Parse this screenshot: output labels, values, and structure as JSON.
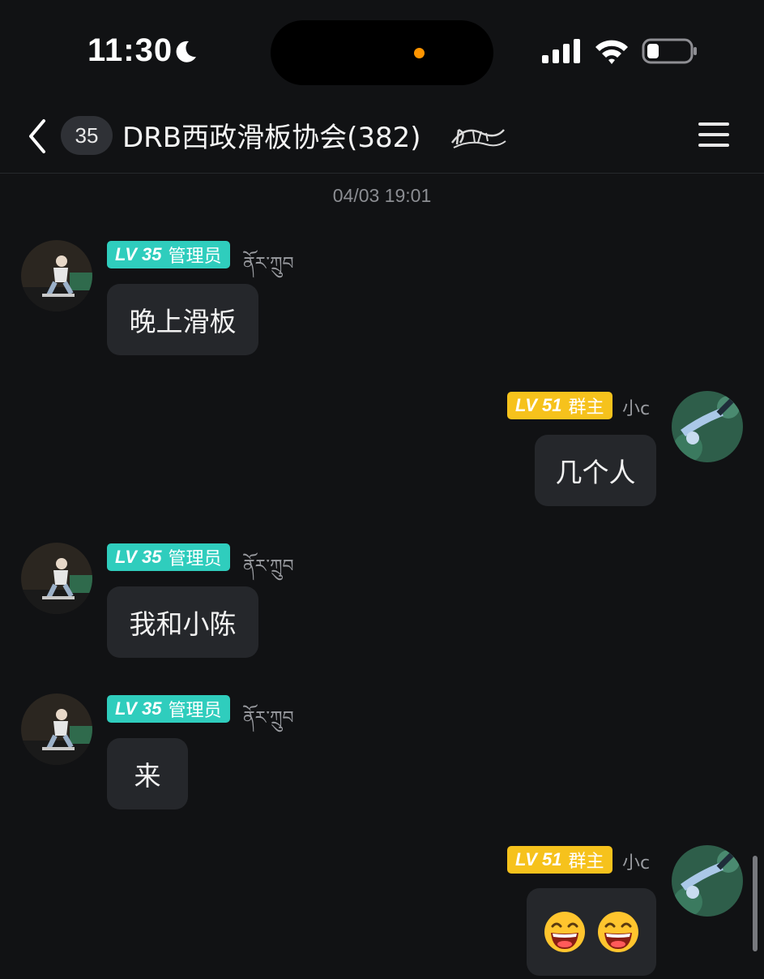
{
  "status_bar": {
    "time": "11:30"
  },
  "header": {
    "unread_count": "35",
    "title": "DRB西政滑板协会(382)"
  },
  "timestamp": "04/03 19:01",
  "messages": [
    {
      "side": "left",
      "level": "LV 35",
      "role": "管理员",
      "name": "ནོར་ཀྲུབ",
      "text": "晚上滑板"
    },
    {
      "side": "right",
      "level": "LV 51",
      "role": "群主",
      "name": "小c",
      "text": "几个人"
    },
    {
      "side": "left",
      "level": "LV 35",
      "role": "管理员",
      "name": "ནོར་ཀྲུབ",
      "text": "我和小陈"
    },
    {
      "side": "left",
      "level": "LV 35",
      "role": "管理员",
      "name": "ནོར་ཀྲུབ",
      "text": "来"
    },
    {
      "side": "right",
      "level": "LV 51",
      "role": "群主",
      "name": "小c",
      "emojis": [
        "grinning-face-emoji",
        "grinning-face-emoji"
      ]
    }
  ],
  "colors": {
    "admin_badge": "#2fcdbd",
    "owner_badge": "#f6c21c",
    "bubble": "#25272b",
    "background": "#111214"
  }
}
